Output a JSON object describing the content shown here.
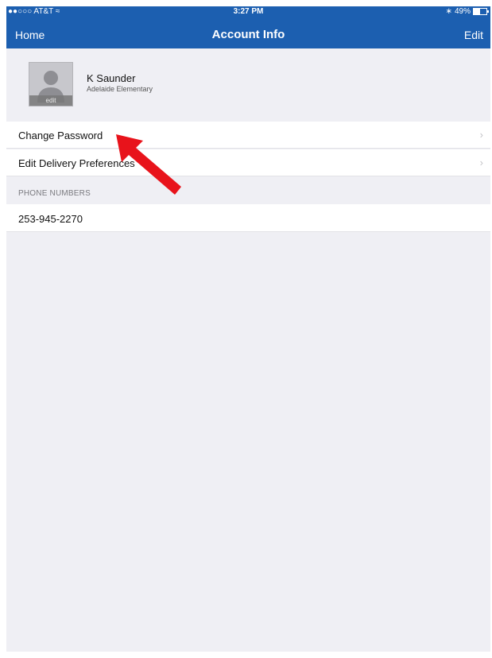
{
  "status_bar": {
    "carrier": "●●○○○ AT&T ≈",
    "time": "3:27 PM",
    "bluetooth": "∗",
    "battery": "49%",
    "battery_level": 0.49
  },
  "nav": {
    "left_label": "Home",
    "title": "Account Info",
    "right_label": "Edit"
  },
  "profile": {
    "avatar_edit_label": "edit",
    "name": "K Saunder",
    "school": "Adelaide Elementary"
  },
  "settings": [
    {
      "label": "Change Password",
      "chevron": "›"
    },
    {
      "label": "Edit Delivery Preferences",
      "chevron": "›"
    }
  ],
  "phone_section": {
    "header": "PHONE NUMBERS",
    "numbers": [
      "253-945-2270"
    ]
  },
  "colors": {
    "nav_blue": "#1c5fb0",
    "background_gray": "#efeff4",
    "annotation_arrow": "#e8131b"
  },
  "icons": [
    "avatar-placeholder-icon",
    "chevron-right-icon",
    "battery-icon",
    "bluetooth-icon",
    "wifi-icon",
    "red-arrow-annotation"
  ]
}
